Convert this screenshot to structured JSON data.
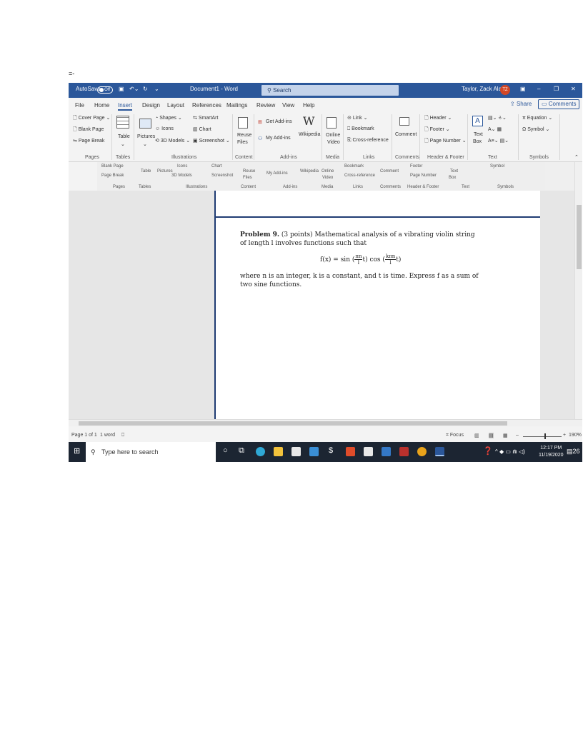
{
  "page_marker": "=-",
  "titlebar": {
    "autosave": "AutoSave",
    "toggle": "Off",
    "document": "Document1 - Word",
    "search": "Search",
    "user": "Taylor, Zack Alan",
    "initials": "TZ"
  },
  "tabs": [
    "File",
    "Home",
    "Insert",
    "Design",
    "Layout",
    "References",
    "Mailings",
    "Review",
    "View",
    "Help"
  ],
  "share": "Share",
  "comments": "Comments",
  "ribbon": {
    "cover_page": "Cover Page",
    "blank_page": "Blank Page",
    "page_break": "Page Break",
    "table": "Table",
    "pictures": "Pictures",
    "shapes": "Shapes",
    "icons": "Icons",
    "models": "3D Models",
    "smartart": "SmartArt",
    "chart": "Chart",
    "screenshot": "Screenshot",
    "reuse": "Reuse",
    "files": "Files",
    "get_addins": "Get Add-ins",
    "my_addins": "My Add-ins",
    "wikipedia": "Wikipedia",
    "online": "Online",
    "video": "Video",
    "link": "Link",
    "bookmark": "Bookmark",
    "cross_reference": "Cross-reference",
    "comment": "Comment",
    "header": "Header",
    "footer": "Footer",
    "page_number": "Page Number",
    "text": "Text",
    "box": "Box",
    "equation": "Equation",
    "symbol": "Symbol",
    "groups": {
      "pages": "Pages",
      "tables": "Tables",
      "illustrations": "Illustrations",
      "content": "Content",
      "addins": "Add-ins",
      "media": "Media",
      "links": "Links",
      "comments": "Comments",
      "header_footer": "Header & Footer",
      "text": "Text",
      "symbols": "Symbols"
    }
  },
  "document": {
    "problem_label": "Problem 9.",
    "problem_text": "(3 points) Mathematical analysis of a vibrating violin string of length l involves functions such that",
    "formula_lhs": "f(x) = sin",
    "frac1_num": "πn",
    "frac1_den": "l",
    "formula_mid": "t) cos",
    "frac2_num": "kπn",
    "frac2_den": "l",
    "formula_end": "t)",
    "after_text": "where n is an integer, k is a constant, and t is time. Express f as a sum of two sine functions."
  },
  "statusbar": {
    "page": "Page 1 of 1",
    "words": "1 word",
    "focus": "Focus",
    "zoom": "190%"
  },
  "taskbar": {
    "search": "Type here to search",
    "time": "12:17 PM",
    "date": "11/19/2020",
    "notifications": "26"
  }
}
